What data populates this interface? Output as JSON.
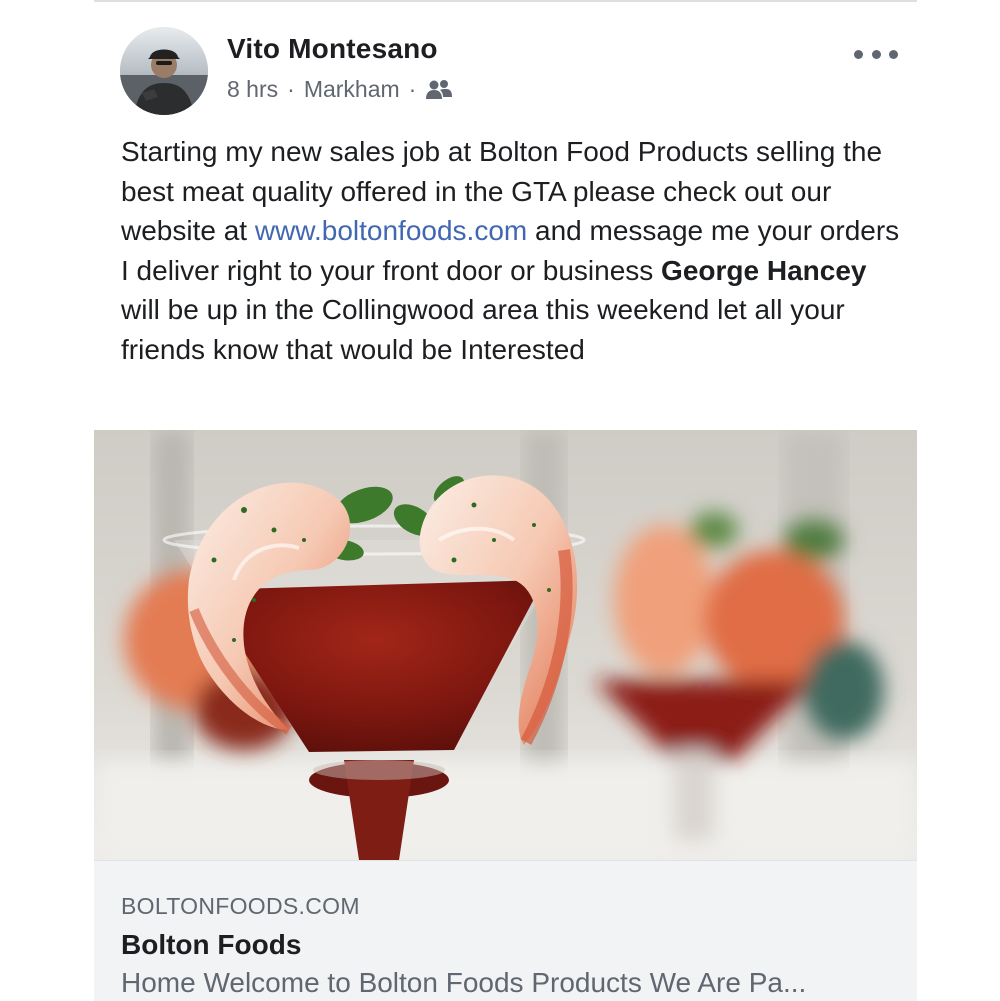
{
  "post": {
    "author": "Vito Montesano",
    "time": "8 hrs",
    "location": "Markham",
    "separator": "·",
    "audience_icon": "friends-icon",
    "more_icon": "more-options-icon",
    "text_parts": {
      "p1": "Starting my new sales job at Bolton Food Products selling the best meat quality offered in the GTA please check out our website at ",
      "link": "www.boltonfoods.com",
      "p2": " and message me your orders I deliver right to your front door or business ",
      "mention": "George Hancey",
      "p3": " will be up in the Collingwood area this weekend let all your friends know that would be Interested"
    }
  },
  "link_preview": {
    "domain": "BOLTONFOODS.COM",
    "title": "Bolton Foods",
    "description": "Home Welcome to Bolton Foods Products We Are Pa..."
  },
  "colors": {
    "link": "#4267b2",
    "secondary_text": "#606770",
    "preview_bg": "#f2f3f5"
  }
}
